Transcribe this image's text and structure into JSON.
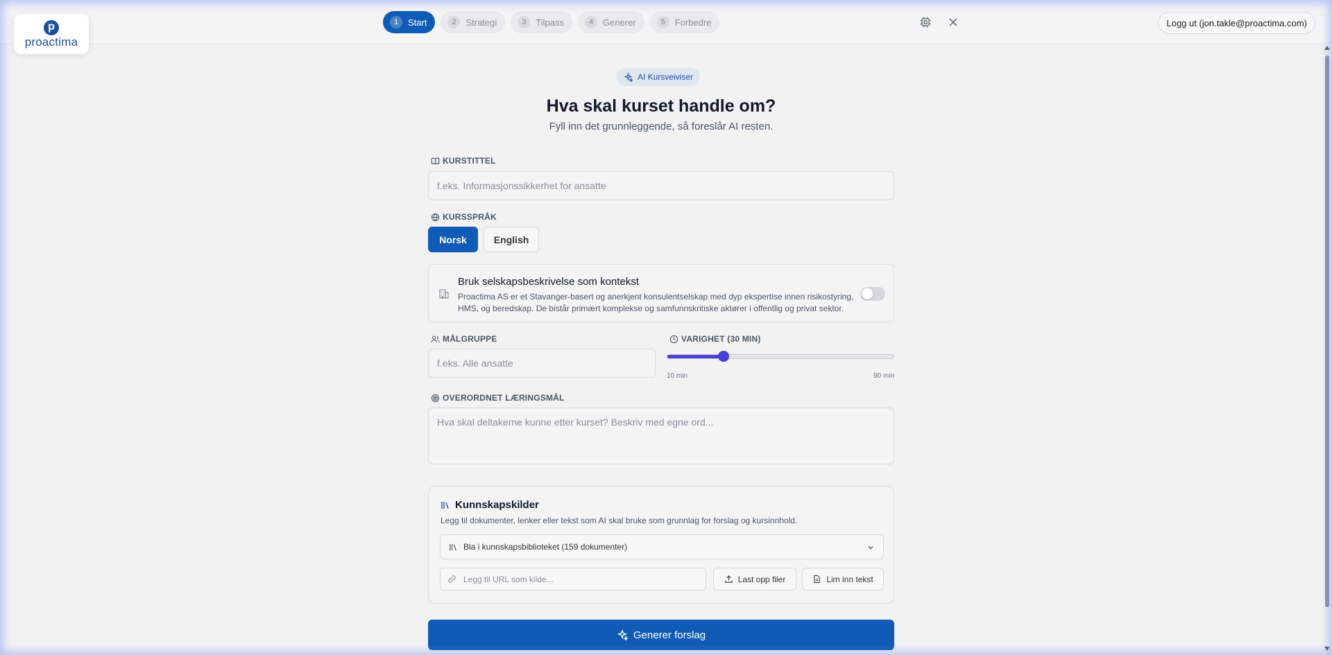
{
  "brand": {
    "logo_letter": "p",
    "logo_text": "proactima"
  },
  "steps": [
    {
      "num": "1",
      "label": "Start",
      "active": true
    },
    {
      "num": "2",
      "label": "Strategi"
    },
    {
      "num": "3",
      "label": "Tilpass"
    },
    {
      "num": "4",
      "label": "Generer"
    },
    {
      "num": "5",
      "label": "Forbedre"
    }
  ],
  "header": {
    "logout_label": "Logg ut (jon.takle@proactima.com)"
  },
  "hero": {
    "badge": "AI Kursveiviser",
    "title": "Hva skal kurset handle om?",
    "subtitle": "Fyll inn det grunnleggende, så foreslår AI resten."
  },
  "form": {
    "title_label": "KURSTITTEL",
    "title_placeholder": "f.eks. Informasjonssikkerhet for ansatte",
    "language_label": "KURSSPRÅK",
    "language_options": [
      "Norsk",
      "English"
    ],
    "language_selected": "Norsk",
    "company": {
      "title": "Bruk selskapsbeskrivelse som kontekst",
      "description": "Proactima AS er et Stavanger-basert og anerkjent konsulentselskap med dyp ekspertise innen risikostyring, HMS, og beredskap. De bistår primært komplekse og samfunnskritiske aktører i offentlig og privat sektor.",
      "enabled": false
    },
    "audience_label": "MÅLGRUPPE",
    "audience_placeholder": "f.eks. Alle ansatte",
    "duration_label": "VARIGHET (30 MIN)",
    "duration": {
      "min": 10,
      "max": 90,
      "value": 30,
      "min_label": "10 min",
      "max_label": "90 min"
    },
    "goal_label": "OVERORDNET LÆRINGSMÅL",
    "goal_placeholder": "Hva skal deltakerne kunne etter kurset? Beskriv med egne ord..."
  },
  "knowledge": {
    "title": "Kunnskapskilder",
    "description": "Legg til dokumenter, lenker eller tekst som AI skal bruke som grunnlag for forslag og kursinnhold.",
    "library_label": "Bla i kunnskapsbiblioteket (159 dokumenter)",
    "url_placeholder": "Legg til URL som kilde...",
    "upload_label": "Last opp filer",
    "paste_label": "Lim inn tekst"
  },
  "actions": {
    "generate_label": "Generer forslag"
  },
  "colors": {
    "primary": "#0f5bb5",
    "slider": "#4b3fd9",
    "brand": "#1d4f9c"
  }
}
